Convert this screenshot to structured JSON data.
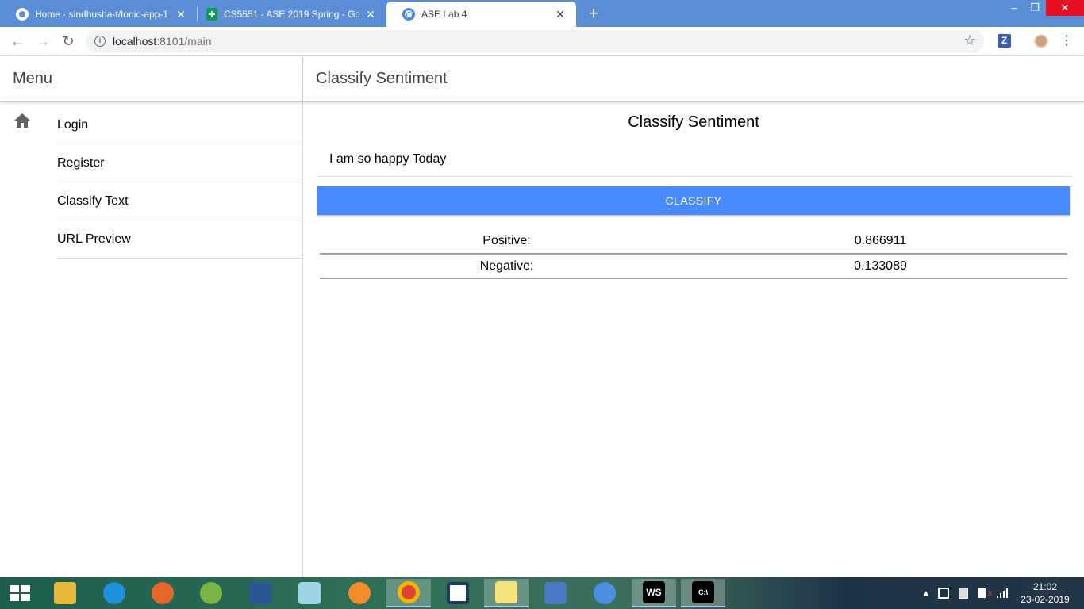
{
  "browser": {
    "tabs": [
      {
        "title": "Home · sindhusha-t/Ionic-app-1",
        "icon": "github-icon"
      },
      {
        "title": "CS5551 - ASE 2019 Spring - Goo",
        "icon": "sheets-icon"
      },
      {
        "title": "ASE Lab 4",
        "icon": "chrome-icon",
        "active": true
      }
    ],
    "url_host": "localhost",
    "url_rest": ":8101/main",
    "extension_label": "Z",
    "glyphs": {
      "back": "←",
      "forward": "→",
      "reload": "↻",
      "star": "☆",
      "close": "✕",
      "new_tab": "+",
      "menu": "⋮",
      "minimize": "–",
      "restore": "❐",
      "window_close": "✕"
    }
  },
  "app": {
    "menu": {
      "title": "Menu",
      "items": [
        {
          "label": "Login",
          "icon": "home-icon"
        },
        {
          "label": "Register"
        },
        {
          "label": "Classify Text"
        },
        {
          "label": "URL Preview"
        }
      ]
    },
    "page_title": "Classify Sentiment",
    "card_title": "Classify Sentiment",
    "input_value": "I am so happy Today",
    "classify_label": "CLASSIFY",
    "results": [
      {
        "label": "Positive:",
        "value": "0.866911"
      },
      {
        "label": "Negative:",
        "value": "0.133089"
      }
    ],
    "accent_color": "#488aff"
  },
  "taskbar": {
    "apps": [
      "file-explorer-icon",
      "internet-explorer-icon",
      "firefox-icon",
      "android-studio-icon",
      "word-icon",
      "notepad-icon",
      "settings-icon",
      "chrome-icon",
      "code-icon",
      "sticky-notes-icon",
      "network-icon",
      "app-icon",
      "webstorm-icon",
      "terminal-icon"
    ],
    "webstorm_label": "WS",
    "terminal_label": "C:\\",
    "tray_arrow": "▲",
    "time": "21:02",
    "date": "23-02-2019"
  }
}
